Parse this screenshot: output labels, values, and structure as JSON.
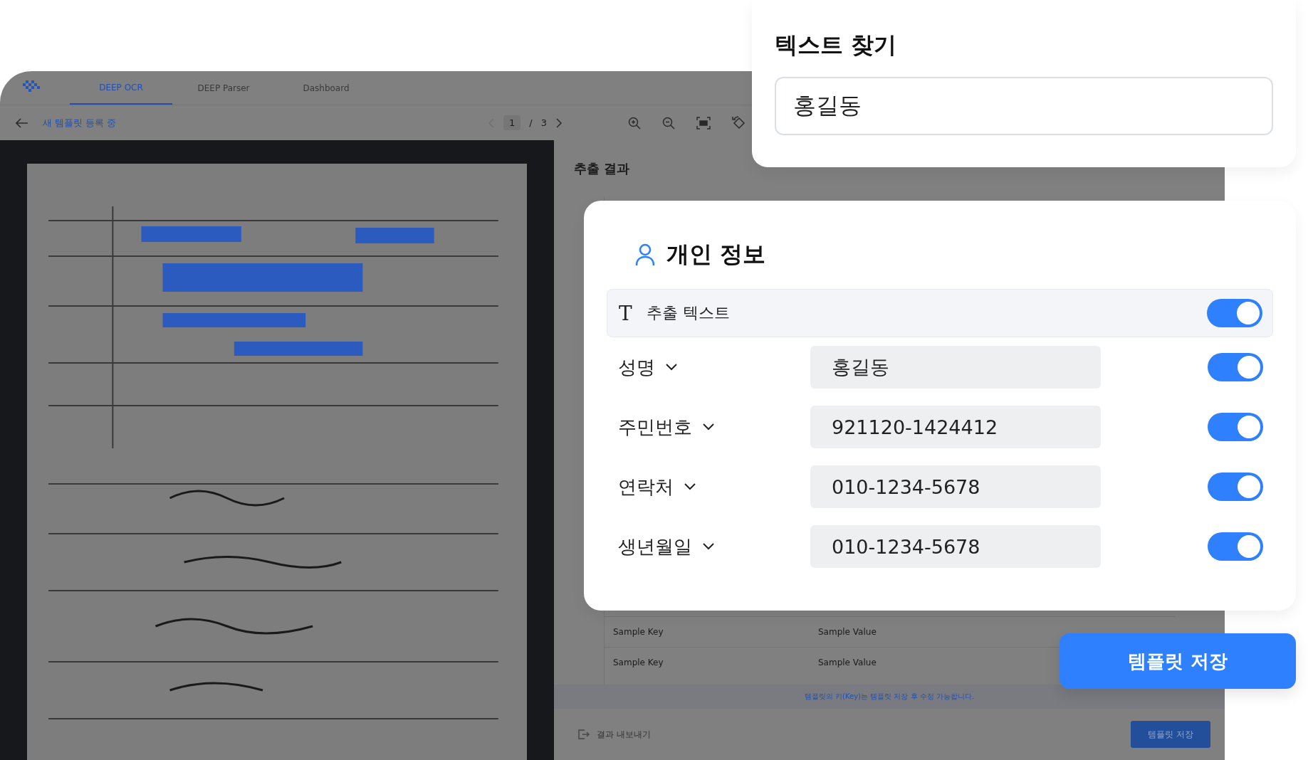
{
  "app": {
    "nav_tabs": [
      {
        "label": "DEEP OCR",
        "selected": true
      },
      {
        "label": "DEEP Parser",
        "selected": false
      },
      {
        "label": "Dashboard",
        "selected": false
      }
    ],
    "breadcrumb": "새 템플릿 등록 중",
    "pager": {
      "current": "1",
      "separator": "/",
      "total": "3"
    },
    "results": {
      "title": "추출 결과",
      "rows": [
        {
          "key": "Sample Key",
          "value": "Sample Value"
        },
        {
          "key": "Sample Key",
          "value": "Sample Value"
        }
      ],
      "hint": "템플릿의 키(Key)는 템플릿 저장 후 수정 가능합니다.",
      "export": "결과 내보내기",
      "save": "템플릿 저장"
    }
  },
  "search_card": {
    "title": "텍스트 찾기",
    "value": "홍길동"
  },
  "info_card": {
    "title": "개인 정보",
    "extract": {
      "icon": "T",
      "label": "추출 텍스트",
      "on": true
    },
    "fields": [
      {
        "label": "성명",
        "value": "홍길동",
        "on": true
      },
      {
        "label": "주민번호",
        "value": "921120-1424412",
        "on": true
      },
      {
        "label": "연락처",
        "value": "010-1234-5678",
        "on": true
      },
      {
        "label": "생년월일",
        "value": "010-1234-5678",
        "on": true
      }
    ]
  },
  "save_button": "템플릿 저장"
}
